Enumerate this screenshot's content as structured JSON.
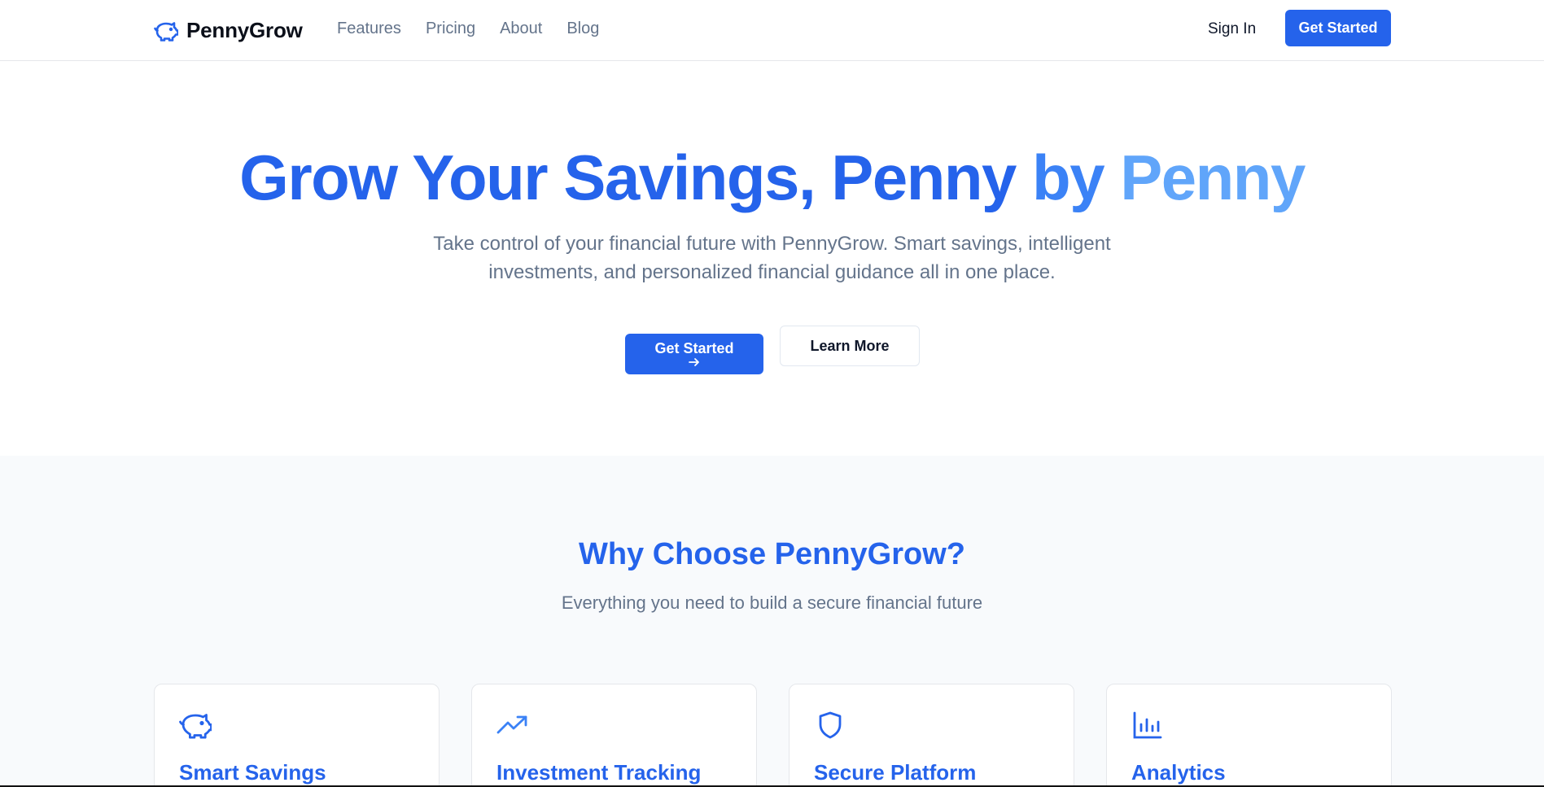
{
  "brand": {
    "name": "PennyGrow",
    "icon": "piggy-bank-icon",
    "accent": "#2563eb"
  },
  "nav": {
    "items": [
      "Features",
      "Pricing",
      "About",
      "Blog"
    ]
  },
  "header": {
    "signin_label": "Sign In",
    "cta_label": "Get Started"
  },
  "hero": {
    "title_part1": "Grow Your Savings,",
    "title_part2": "Penny",
    "title_part3": "by",
    "title_part4": "Penny",
    "subtitle": "Take control of your financial future with PennyGrow. Smart savings, intelligent investments, and personalized financial guidance all in one place.",
    "cta_label": "Get Started",
    "cta_icon": "arrow-right-icon",
    "secondary_label": "Learn More"
  },
  "features": {
    "title": "Why Choose PennyGrow?",
    "subtitle": "Everything you need to build a secure financial future",
    "cards": [
      {
        "title": "Smart Savings",
        "icon": "piggy-bank-icon"
      },
      {
        "title": "Investment Tracking",
        "icon": "trending-up-icon"
      },
      {
        "title": "Secure Platform",
        "icon": "shield-icon"
      },
      {
        "title": "Analytics",
        "icon": "bar-chart-icon"
      }
    ]
  }
}
